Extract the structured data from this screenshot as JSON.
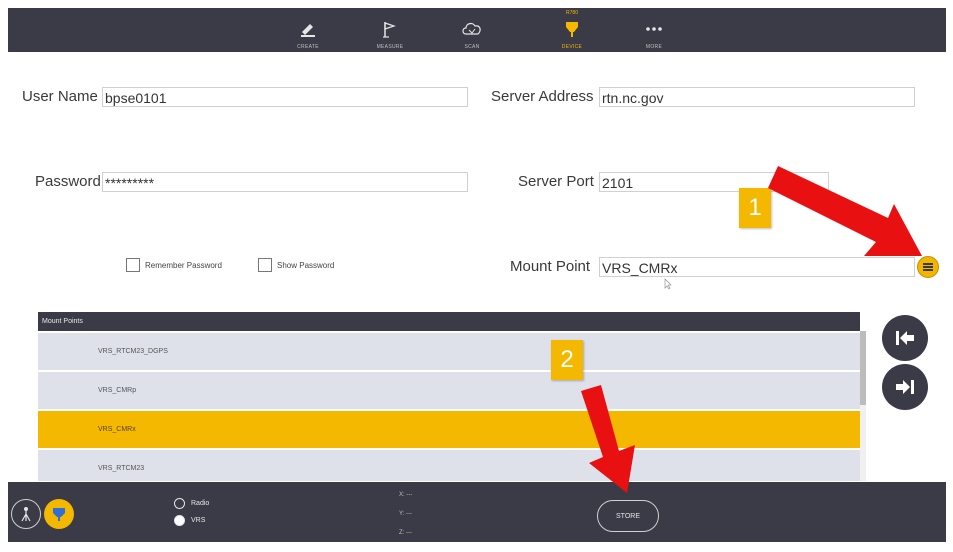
{
  "colors": {
    "bar": "#3a3b46",
    "accent": "#f5b800",
    "arrow": "#e81010",
    "row": "#dfe1ea"
  },
  "nav": {
    "items": [
      {
        "label": "CREATE",
        "icon": "pencil-icon"
      },
      {
        "label": "MEASURE",
        "icon": "flag-icon"
      },
      {
        "label": "SCAN",
        "icon": "cloud-icon"
      },
      {
        "label": "DEVICE",
        "top": "R780",
        "icon": "receiver-icon",
        "active": true
      },
      {
        "label": "MORE",
        "icon": "more-dots-icon"
      }
    ]
  },
  "form": {
    "username_label": "User Name",
    "username_value": "bpse0101",
    "password_label": "Password",
    "password_value": "*********",
    "server_address_label": "Server Address",
    "server_address_value": "rtn.nc.gov",
    "server_port_label": "Server Port",
    "server_port_value": "2101",
    "mount_point_label": "Mount Point",
    "mount_point_value": "VRS_CMRx",
    "remember_password": "Remember Password",
    "show_password": "Show Password"
  },
  "mount_points": {
    "header": "Mount Points",
    "items": [
      {
        "name": "VRS_RTCM23_DGPS",
        "selected": false
      },
      {
        "name": "VRS_CMRp",
        "selected": false
      },
      {
        "name": "VRS_CMRx",
        "selected": true
      },
      {
        "name": "VRS_RTCM23",
        "selected": false
      }
    ]
  },
  "callouts": {
    "one": "1",
    "two": "2"
  },
  "bottom": {
    "radio_option": "Radio",
    "vrs_option": "VRS",
    "selected_mode": "VRS",
    "x_label": "X: ---",
    "y_label": "Y: ---",
    "z_label": "Z: ---",
    "store_label": "STORE"
  }
}
